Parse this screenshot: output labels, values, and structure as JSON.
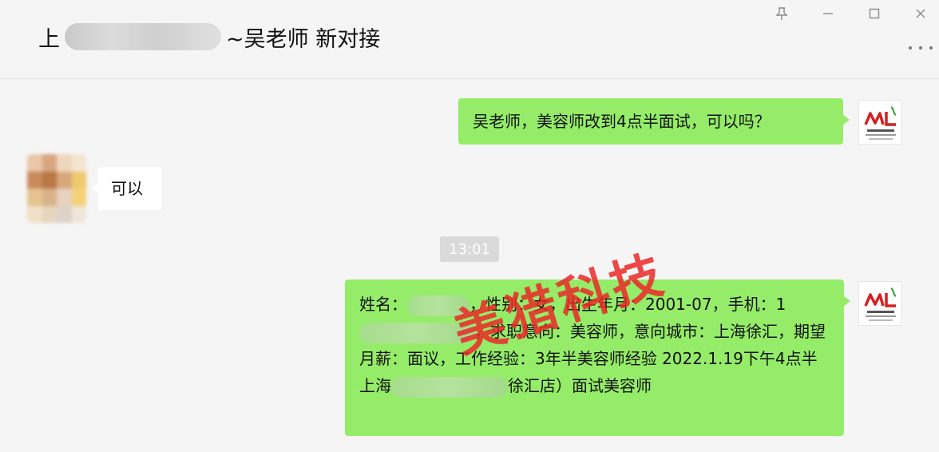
{
  "window": {
    "title_prefix": "上",
    "title_suffix": "~吴老师 新对接"
  },
  "messages": [
    {
      "side": "right",
      "text": "吴老师，美容师改到4点半面试，可以吗？"
    },
    {
      "side": "left",
      "text": "可以"
    },
    {
      "side": "right",
      "parts": [
        "姓名：",
        "[redacted]",
        "，性别：女，出生年月：2001-07，手机：1",
        "[redacted]",
        "，求职意向：美容师，意向城市：上海徐汇，期望月薪：面议，工作经验：3年半美容师经验 2022.1.19下午4点半上海",
        "[redacted]",
        "徐汇店）面试美容师"
      ]
    }
  ],
  "timestamp": "13:01",
  "watermark": "美猎科技",
  "colors": {
    "self_bubble": "#95ec69",
    "other_bubble": "#ffffff",
    "background": "#f5f5f5",
    "watermark": "#eb2828"
  },
  "icons": {
    "pin": "pin-icon",
    "minimize": "minimize-icon",
    "maximize": "maximize-icon",
    "close": "close-icon",
    "more": "more-icon"
  }
}
